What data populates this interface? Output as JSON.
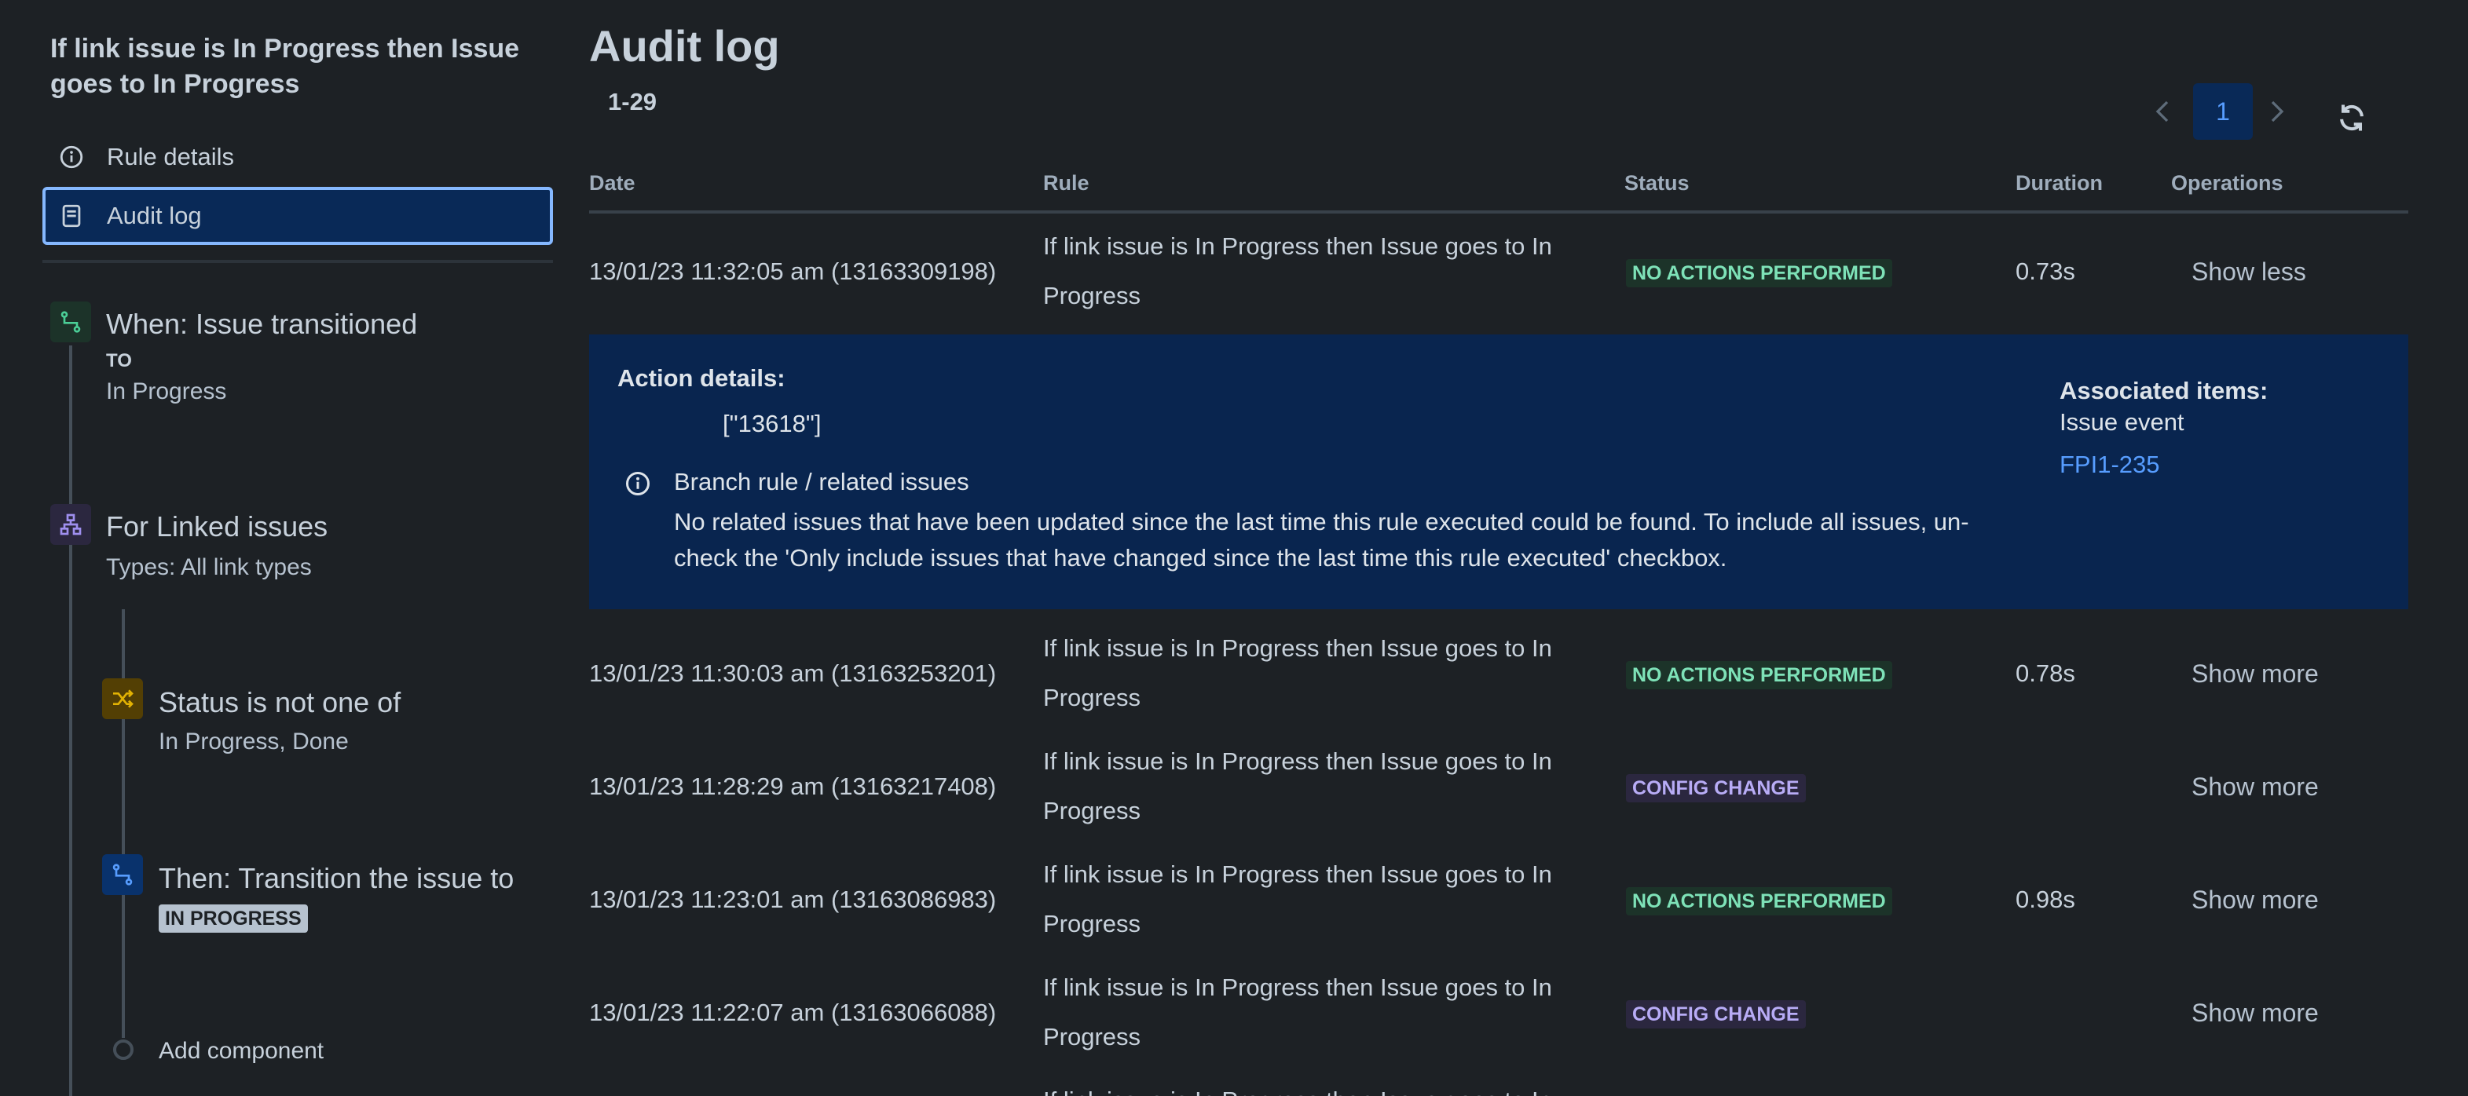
{
  "sidebar": {
    "rule_title": "If link issue is In Progress then Issue goes to In Progress",
    "nav": [
      {
        "label": "Rule details",
        "icon": "info-icon"
      },
      {
        "label": "Audit log",
        "icon": "document-icon"
      }
    ],
    "components": {
      "trigger": {
        "title": "When: Issue transitioned",
        "to_label": "TO",
        "value": "In Progress",
        "icon": "trigger-icon",
        "color": "#1f845a"
      },
      "branch": {
        "title": "For Linked issues",
        "sub": "Types: All link types",
        "icon": "hierarchy-icon",
        "color": "#8f7ee7"
      },
      "condition": {
        "title": "Status is not one of",
        "sub": "In Progress, Done",
        "icon": "shuffle-icon",
        "color": "#e2b203"
      },
      "action": {
        "title": "Then: Transition the issue to",
        "lozenge": "IN PROGRESS",
        "icon": "action-icon",
        "color": "#579dff"
      },
      "add_component": "Add component"
    }
  },
  "main": {
    "title": "Audit log",
    "range": "1-29",
    "pagination": {
      "current_page": "1"
    },
    "columns": {
      "date": "Date",
      "rule": "Rule",
      "status": "Status",
      "duration": "Duration",
      "operations": "Operations"
    },
    "rows": [
      {
        "date": "13/01/23 11:32:05 am (13163309198)",
        "rule": "If link issue is In Progress then Issue goes to In Progress",
        "status": "NO ACTIONS PERFORMED",
        "status_kind": "green",
        "duration": "0.73s",
        "op": "Show less"
      },
      {
        "date": "13/01/23 11:30:03 am (13163253201)",
        "rule": "If link issue is In Progress then Issue goes to In Progress",
        "status": "NO ACTIONS PERFORMED",
        "status_kind": "green",
        "duration": "0.78s",
        "op": "Show more"
      },
      {
        "date": "13/01/23 11:28:29 am (13163217408)",
        "rule": "If link issue is In Progress then Issue goes to In Progress",
        "status": "CONFIG CHANGE",
        "status_kind": "purple",
        "duration": "",
        "op": "Show more"
      },
      {
        "date": "13/01/23 11:23:01 am (13163086983)",
        "rule": "If link issue is In Progress then Issue goes to In Progress",
        "status": "NO ACTIONS PERFORMED",
        "status_kind": "green",
        "duration": "0.98s",
        "op": "Show more"
      },
      {
        "date": "13/01/23 11:22:07 am (13163066088)",
        "rule": "If link issue is In Progress then Issue goes to In Progress",
        "status": "CONFIG CHANGE",
        "status_kind": "purple",
        "duration": "",
        "op": "Show more"
      },
      {
        "date": "",
        "rule": "If link issue is In Progress then Issue goes to In",
        "status": "",
        "status_kind": "",
        "duration": "",
        "op": ""
      }
    ],
    "details": {
      "action_heading": "Action details:",
      "action_value": "[\"13618\"]",
      "info_title": "Branch rule / related issues",
      "info_text": "No related issues that have been updated since the last time this rule executed could be found. To include all issues, un-check the 'Only include issues that have changed since the last time this rule executed' checkbox.",
      "assoc_heading": "Associated items:",
      "assoc_type": "Issue event",
      "assoc_link": "FPI1-235"
    }
  }
}
